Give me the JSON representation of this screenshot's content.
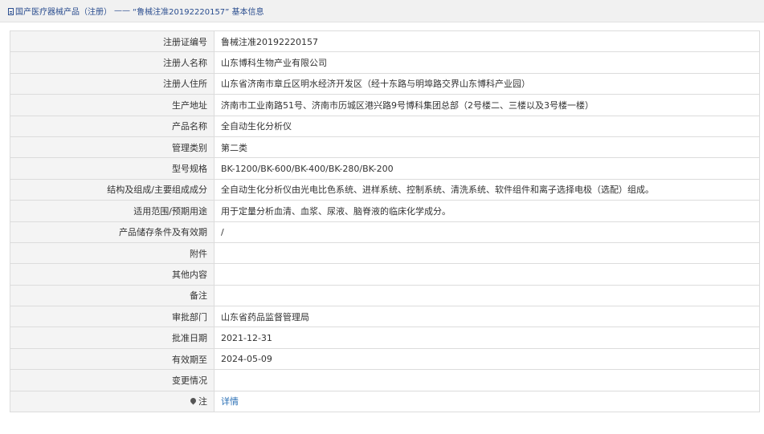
{
  "breadcrumb": {
    "root_label": "国产医疗器械产品（注册）",
    "separator": "——",
    "current_label": "“鲁械注准20192220157” 基本信息"
  },
  "fields": [
    {
      "label": "注册证编号",
      "value": "鲁械注准20192220157"
    },
    {
      "label": "注册人名称",
      "value": "山东博科生物产业有限公司"
    },
    {
      "label": "注册人住所",
      "value": "山东省济南市章丘区明水经济开发区（经十东路与明埠路交界山东博科产业园）"
    },
    {
      "label": "生产地址",
      "value": "济南市工业南路51号、济南市历城区港兴路9号博科集团总部（2号楼二、三楼以及3号楼一楼）"
    },
    {
      "label": "产品名称",
      "value": "全自动生化分析仪"
    },
    {
      "label": "管理类别",
      "value": "第二类"
    },
    {
      "label": "型号规格",
      "value": "BK-1200/BK-600/BK-400/BK-280/BK-200"
    },
    {
      "label": "结构及组成/主要组成成分",
      "value": "全自动生化分析仪由光电比色系统、进样系统、控制系统、清洗系统、软件组件和离子选择电极（选配）组成。"
    },
    {
      "label": "适用范围/预期用途",
      "value": "用于定量分析血清、血浆、尿液、脑脊液的临床化学成分。"
    },
    {
      "label": "产品储存条件及有效期",
      "value": "/"
    },
    {
      "label": "附件",
      "value": ""
    },
    {
      "label": "其他内容",
      "value": ""
    },
    {
      "label": "备注",
      "value": ""
    },
    {
      "label": "审批部门",
      "value": "山东省药品监督管理局"
    },
    {
      "label": "批准日期",
      "value": "2021-12-31"
    },
    {
      "label": "有效期至",
      "value": "2024-05-09"
    },
    {
      "label": "变更情况",
      "value": ""
    }
  ],
  "note": {
    "icon": "pin-icon",
    "label": "注",
    "link_text": "详情"
  },
  "colors": {
    "link": "#2a6fb5",
    "breadcrumb": "#2a4d8f",
    "label_bg": "#f4f4f4",
    "border": "#dcdcdc"
  }
}
